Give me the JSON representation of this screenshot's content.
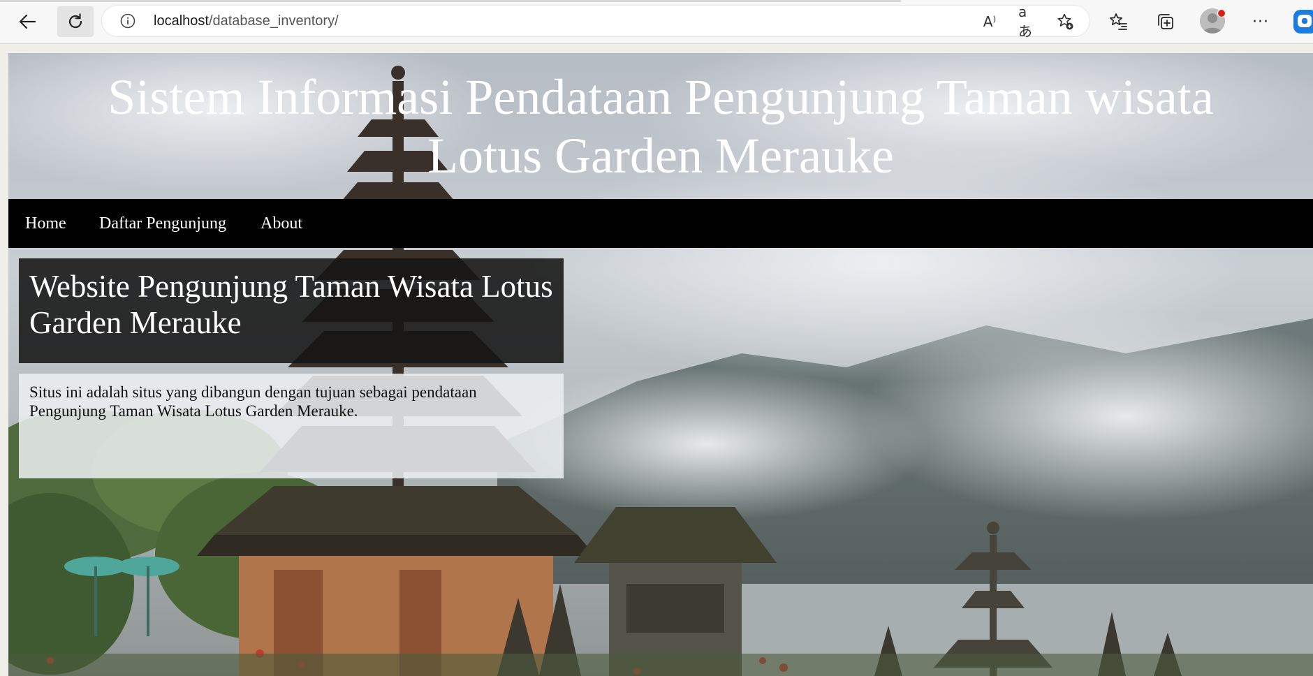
{
  "browser": {
    "url_host": "localhost",
    "url_path": "/database_inventory/",
    "icons": {
      "back": "back-arrow-icon",
      "reload": "reload-icon",
      "site_info": "info-icon",
      "read_aloud": "read-aloud-icon",
      "translate": "translate-icon",
      "add_favorite": "star-plus-icon",
      "favorites": "favorites-icon",
      "collections": "collections-icon",
      "profile": "profile-avatar",
      "more": "more-icon",
      "copilot": "copilot-icon"
    },
    "read_aloud_glyph": "A⁾",
    "translate_glyph": "aあ",
    "more_glyph": "···"
  },
  "site": {
    "title": "Sistem Informasi Pendataan Pengunjung Taman wisata Lotus Garden Merauke",
    "nav": [
      {
        "label": "Home"
      },
      {
        "label": "Daftar Pengunjung"
      },
      {
        "label": "About"
      }
    ],
    "content": {
      "heading": "Website Pengunjung Taman Wisata Lotus Garden Merauke",
      "description": "Situs ini adalah situs yang dibangun dengan tujuan sebagai pendataan Pengunjung Taman Wisata Lotus Garden Merauke."
    }
  },
  "colors": {
    "nav_bg": "#000000",
    "title_text": "#ffffff",
    "heading_box": "#141414",
    "desc_box": "#ecf0f2"
  }
}
